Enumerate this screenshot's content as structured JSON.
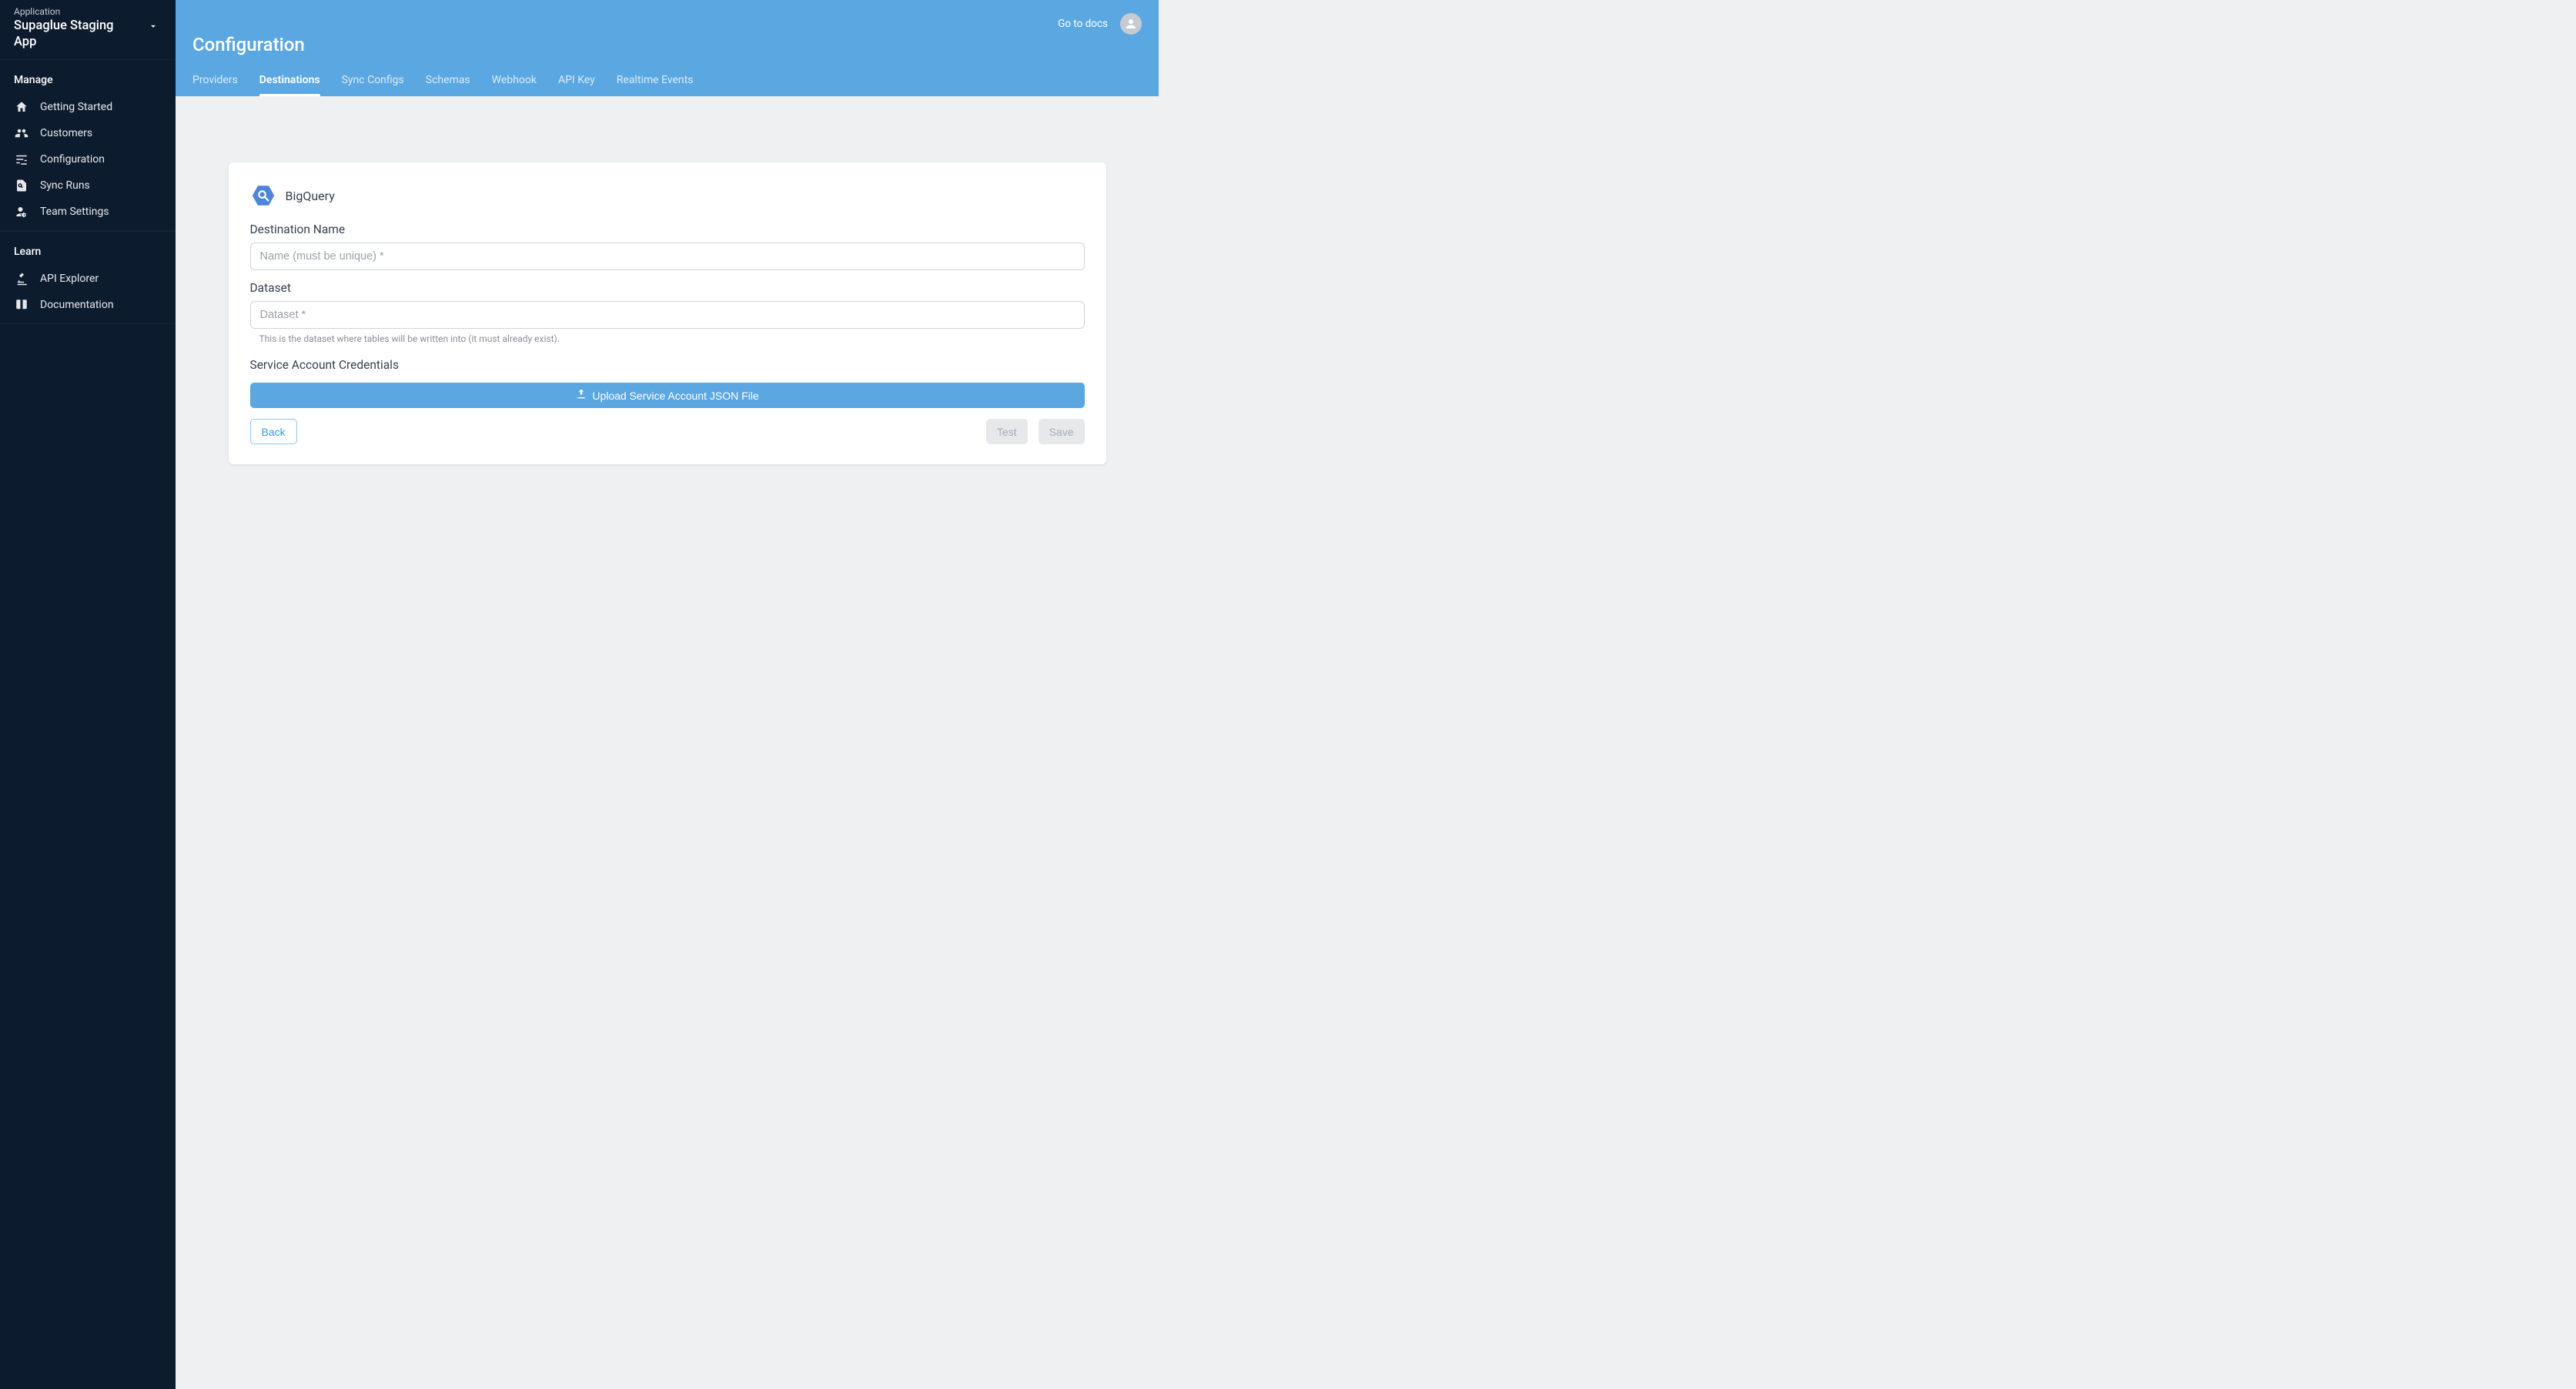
{
  "sidebar": {
    "application_label": "Application",
    "app_name": "Supaglue Staging App",
    "manage_title": "Manage",
    "learn_title": "Learn",
    "manage_items": [
      {
        "label": "Getting Started",
        "name": "sidebar-item-getting-started"
      },
      {
        "label": "Customers",
        "name": "sidebar-item-customers"
      },
      {
        "label": "Configuration",
        "name": "sidebar-item-configuration"
      },
      {
        "label": "Sync Runs",
        "name": "sidebar-item-sync-runs"
      },
      {
        "label": "Team Settings",
        "name": "sidebar-item-team-settings"
      }
    ],
    "learn_items": [
      {
        "label": "API Explorer",
        "name": "sidebar-item-api-explorer"
      },
      {
        "label": "Documentation",
        "name": "sidebar-item-documentation"
      }
    ]
  },
  "header": {
    "docs_link": "Go to docs",
    "page_title": "Configuration",
    "tabs": [
      {
        "label": "Providers",
        "name": "tab-providers",
        "active": false
      },
      {
        "label": "Destinations",
        "name": "tab-destinations",
        "active": true
      },
      {
        "label": "Sync Configs",
        "name": "tab-sync-configs",
        "active": false
      },
      {
        "label": "Schemas",
        "name": "tab-schemas",
        "active": false
      },
      {
        "label": "Webhook",
        "name": "tab-webhook",
        "active": false
      },
      {
        "label": "API Key",
        "name": "tab-api-key",
        "active": false
      },
      {
        "label": "Realtime Events",
        "name": "tab-realtime-events",
        "active": false
      }
    ]
  },
  "form": {
    "destination_title": "BigQuery",
    "name_label": "Destination Name",
    "name_placeholder": "Name (must be unique) *",
    "dataset_label": "Dataset",
    "dataset_placeholder": "Dataset *",
    "dataset_helper": "This is the dataset where tables will be written into (it must already exist).",
    "creds_label": "Service Account Credentials",
    "upload_label": "Upload Service Account JSON File",
    "back_label": "Back",
    "test_label": "Test",
    "save_label": "Save"
  }
}
